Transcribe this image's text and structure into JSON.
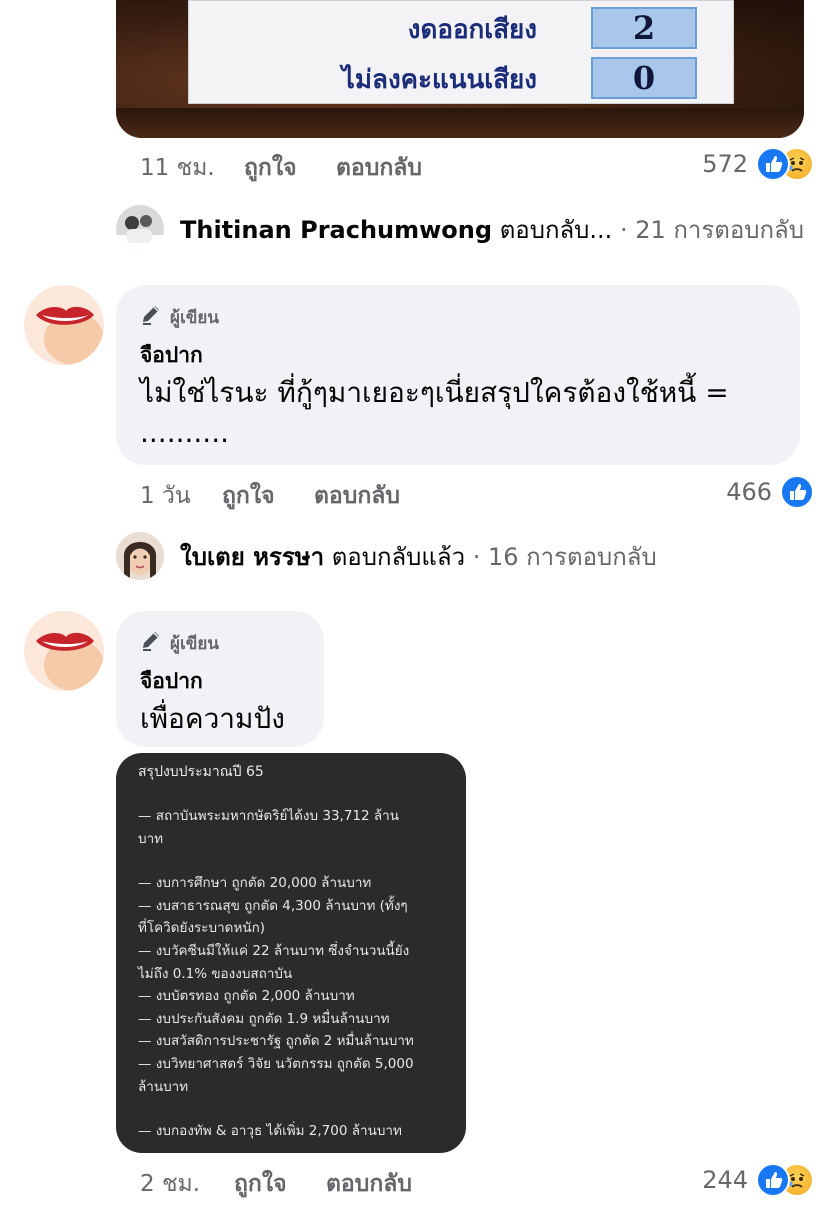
{
  "vote_board": {
    "rows": [
      {
        "label": "งดออกเสียง",
        "value": "2"
      },
      {
        "label": "ไม่ลงคะแนนเสียง",
        "value": "0"
      }
    ]
  },
  "comments": [
    {
      "time": "11 ชม.",
      "like_label": "ถูกใจ",
      "reply_label": "ตอบกลับ",
      "reaction_count": "572",
      "reactions": [
        "like",
        "sad"
      ]
    },
    {
      "badge": "ผู้เขียน",
      "author": "จือปาก",
      "text": "ไม่ใช่ไรนะ ที่กู้ๆมาเยอะๆเนี่ยสรุปใครต้องใช้หนี้ = ..........",
      "text_line1": "ไม่ใช่ไรนะ ที่กู้ๆมาเยอะๆเนี่ยสรุปใครต้องใช้หนี้ =",
      "text_line2": "..........",
      "time": "1 วัน",
      "like_label": "ถูกใจ",
      "reply_label": "ตอบกลับ",
      "reaction_count": "466",
      "reactions": [
        "like"
      ]
    },
    {
      "badge": "ผู้เขียน",
      "author": "จือปาก",
      "text": "เพื่อความปัง",
      "time": "2 ชม.",
      "like_label": "ถูกใจ",
      "reply_label": "ตอบกลับ",
      "reaction_count": "244",
      "reactions": [
        "like",
        "sad"
      ]
    }
  ],
  "reply_previews": [
    {
      "name": "Thitinan Prachumwong",
      "action": "ตอบกลับ...",
      "count": "· 21 การตอบกลับ"
    },
    {
      "name": "ใบเตย หรรษา",
      "action": "ตอบกลับแล้ว",
      "count": "· 16 การตอบกลับ"
    }
  ],
  "attached_card": {
    "title": "สรุปงบประมาณปี 65",
    "lines": [
      "— สถาบันพระมหากษัตริย์ได้งบ 33,712 ล้าน",
      "บาท",
      "",
      "— งบการศึกษา ถูกตัด 20,000 ล้านบาท",
      "— งบสาธารณสุข ถูกตัด 4,300 ล้านบาท (ทั้งๆ",
      "ที่โควิดยังระบาดหนัก)",
      "— งบวัคซีนมีให้แค่ 22 ล้านบาท ซึ่งจำนวนนี้ยัง",
      "ไม่ถึง 0.1% ของงบสถาบัน",
      "— งบบัตรทอง ถูกตัด 2,000 ล้านบาท",
      "— งบประกันสังคม ถูกตัด 1.9 หมื่นล้านบาท",
      "— งบสวัสดิการประชารัฐ ถูกตัด 2 หมื่นล้านบาท",
      "— งบวิทยาศาสตร์ วิจัย นวัตกรรม ถูกตัด 5,000",
      "ล้านบาท",
      "",
      "— งบกองทัพ & อาวุธ ได้เพิ่ม 2,700 ล้านบาท"
    ]
  },
  "colors": {
    "bubble_bg": "#f0f2f5",
    "secondary_text": "#65676b",
    "like_blue": "#1877f2",
    "card_bg": "#2b2b2b"
  }
}
